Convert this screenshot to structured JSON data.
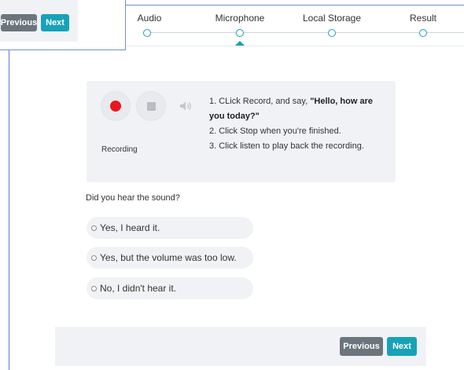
{
  "top_nav": {
    "previous_label": "Previous",
    "next_label": "Next"
  },
  "stepper": {
    "steps": [
      {
        "label": "Audio",
        "state": "complete"
      },
      {
        "label": "Microphone",
        "state": "active"
      },
      {
        "label": "Local Storage",
        "state": "pending"
      },
      {
        "label": "Result",
        "state": "pending"
      }
    ]
  },
  "recorder": {
    "status": "Recording",
    "record_icon": "record-icon",
    "stop_icon": "stop-icon",
    "play_icon": "speaker-icon",
    "instructions": {
      "step1_prefix": "1. CLick Record, and say, ",
      "step1_quote": "\"Hello, how are you today?\"",
      "step2": "2. Click Stop when you're finished.",
      "step3": "3. Click listen to play back the recording."
    }
  },
  "question": {
    "text": "Did you hear the sound?",
    "options": [
      "Yes, I heard it.",
      "Yes, but the volume was too low.",
      "No, I didn't hear it."
    ]
  },
  "bottom_nav": {
    "previous_label": "Previous",
    "next_label": "Next"
  },
  "colors": {
    "accent": "#17a2b8",
    "secondary": "#6c757d",
    "record": "#e8191c",
    "panel": "#f1f2f5"
  }
}
